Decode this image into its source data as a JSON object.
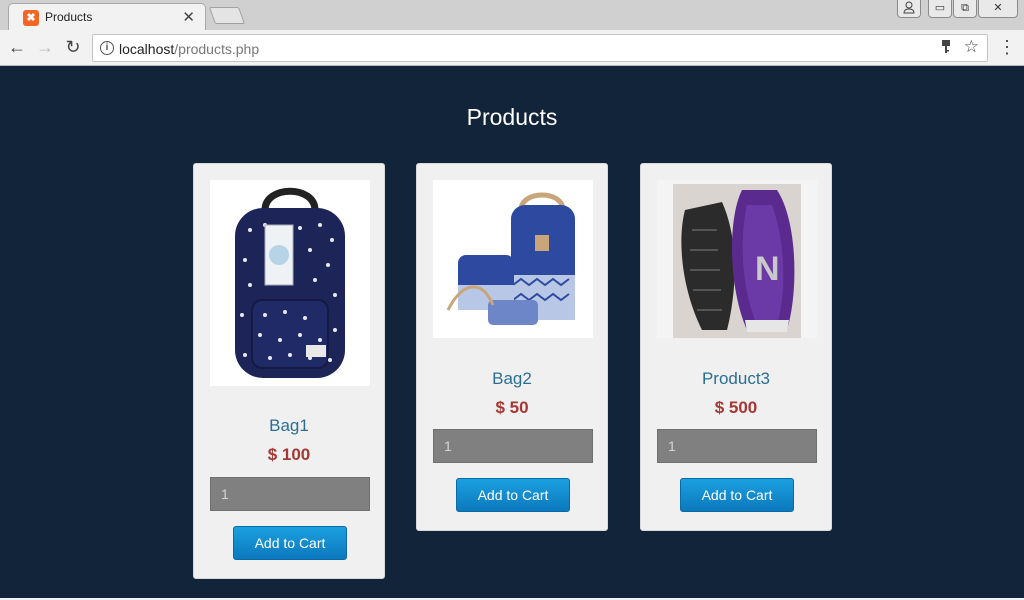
{
  "browser": {
    "tab_title": "Products",
    "tab_close": "✕",
    "url_host": "localhost",
    "url_path": "/products.php"
  },
  "page": {
    "title": "Products"
  },
  "products": [
    {
      "name": "Bag1",
      "price": "$ 100",
      "qty": "1",
      "button": "Add to Cart"
    },
    {
      "name": "Bag2",
      "price": "$ 50",
      "qty": "1",
      "button": "Add to Cart"
    },
    {
      "name": "Product3",
      "price": "$ 500",
      "qty": "1",
      "button": "Add to Cart"
    }
  ],
  "colors": {
    "page_bg": "#11243a",
    "card_bg": "#f0f0f0",
    "name": "#2a6f93",
    "price": "#a43834",
    "button": "#1b8fd2"
  }
}
